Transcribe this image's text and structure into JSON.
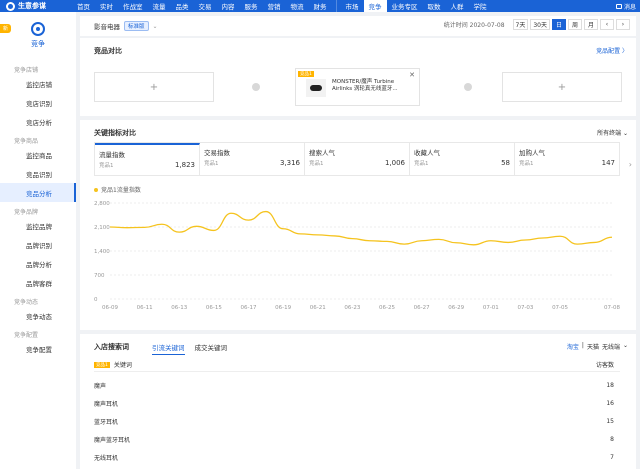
{
  "topbar": {
    "logo": "生意参谋",
    "nav": [
      "首页",
      "实时",
      "作战室",
      "流量",
      "品类",
      "交易",
      "内容",
      "服务",
      "营销",
      "物流",
      "财务",
      "市场",
      "竞争",
      "业务专区",
      "取数",
      "人群",
      "学院"
    ],
    "active": "竞争",
    "message": "消息"
  },
  "sidebar": {
    "badge": "新",
    "head": "竞争",
    "groups": [
      {
        "title": "竞争店铺",
        "items": [
          "监控店铺",
          "竞店识别",
          "竞店分析"
        ]
      },
      {
        "title": "竞争商品",
        "items": [
          "监控商品",
          "竞品识别",
          "竞品分析"
        ]
      },
      {
        "title": "竞争品牌",
        "items": [
          "监控品牌",
          "品牌识别",
          "品牌分析",
          "品牌客群"
        ]
      },
      {
        "title": "竞争动态",
        "items": [
          "竞争动态"
        ]
      },
      {
        "title": "竞争配置",
        "items": [
          "竞争配置"
        ]
      }
    ],
    "active_item": "竞品分析"
  },
  "subbar": {
    "category": "影音电器",
    "tag": "标准版",
    "stat_time": "统计时间 2020-07-08",
    "ranges": [
      "7天",
      "30天",
      "日",
      "周",
      "月"
    ],
    "active_range": "日"
  },
  "compare": {
    "title": "竞品对比",
    "config_link": "竞品配置 〉",
    "card": {
      "tag": "竞品1",
      "name": "MONSTER/魔声 Turbine Airlinks 涡轮真无线蓝牙..."
    }
  },
  "metrics_panel": {
    "title": "关键指标对比",
    "filter": "所有终端 ⌄",
    "metrics": [
      {
        "name": "流量指数",
        "sub": "竞品1",
        "value": "1,823"
      },
      {
        "name": "交易指数",
        "sub": "竞品1",
        "value": "3,316"
      },
      {
        "name": "搜索人气",
        "sub": "竞品1",
        "value": "1,006"
      },
      {
        "name": "收藏人气",
        "sub": "竞品1",
        "value": "58"
      },
      {
        "name": "加购人气",
        "sub": "竞品1",
        "value": "147"
      }
    ],
    "legend": "竞品1流量指数"
  },
  "chart_data": {
    "type": "line",
    "title": "",
    "xlabel": "",
    "ylabel": "",
    "ylim": [
      0,
      2800
    ],
    "yticks": [
      0,
      700,
      1400,
      2100,
      2800
    ],
    "ytick_labels": [
      "0",
      "700",
      "1,400",
      "2,100",
      "2,800"
    ],
    "xtick_labels": [
      "06-09",
      "06-11",
      "06-13",
      "06-15",
      "06-17",
      "06-19",
      "06-21",
      "06-23",
      "06-25",
      "06-27",
      "06-29",
      "07-01",
      "07-03",
      "07-05",
      "07-08"
    ],
    "series": [
      {
        "name": "竞品1流量指数",
        "color": "#f5c31e",
        "x": [
          "06-09",
          "06-10",
          "06-11",
          "06-12",
          "06-13",
          "06-14",
          "06-15",
          "06-16",
          "06-17",
          "06-18",
          "06-19",
          "06-20",
          "06-21",
          "06-22",
          "06-23",
          "06-24",
          "06-25",
          "06-26",
          "06-27",
          "06-28",
          "06-29",
          "06-30",
          "07-01",
          "07-02",
          "07-03",
          "07-04",
          "07-05",
          "07-06",
          "07-07",
          "07-08"
        ],
        "values": [
          2100,
          2080,
          2090,
          2180,
          1950,
          2120,
          2000,
          2500,
          2300,
          2550,
          2050,
          1900,
          1870,
          1840,
          1760,
          1700,
          1680,
          1600,
          1700,
          1740,
          1640,
          1580,
          1700,
          1650,
          1720,
          1780,
          1830,
          1600,
          1650,
          1800
        ]
      }
    ]
  },
  "keywords": {
    "title": "入店搜索词",
    "tabs": [
      "引流关键词",
      "成交关键词"
    ],
    "active_tab": "引流关键词",
    "platforms": [
      "淘宝",
      "天猫",
      "无线端"
    ],
    "header_tag": "竞品1",
    "header_col": "关键词",
    "header_right": "访客数",
    "rows": [
      {
        "keyword": "魔声",
        "value": "18"
      },
      {
        "keyword": "魔声耳机",
        "value": "16"
      },
      {
        "keyword": "蓝牙耳机",
        "value": "15"
      },
      {
        "keyword": "魔声蓝牙耳机",
        "value": "8"
      },
      {
        "keyword": "无线耳机",
        "value": "7"
      }
    ]
  }
}
